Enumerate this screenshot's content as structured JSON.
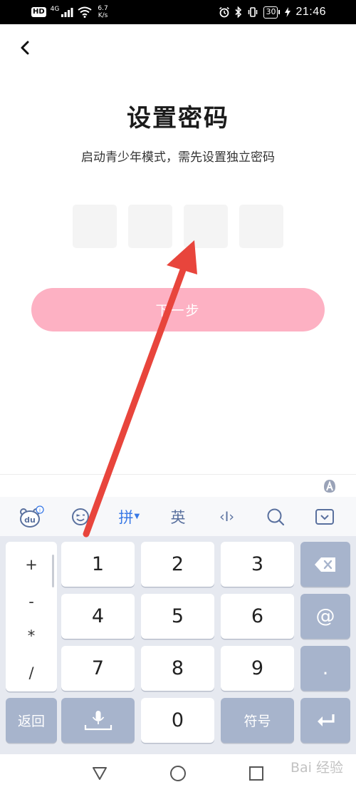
{
  "status_bar": {
    "hd": "HD",
    "network": "4G",
    "speed_value": "6.7",
    "speed_unit": "K/s",
    "battery": "30",
    "time": "21:46"
  },
  "page": {
    "title": "设置密码",
    "subtitle": "启动青少年模式，需先设置独立密码",
    "pin_length": 4,
    "next_label": "下一步",
    "accent_color": "#fdb1c3"
  },
  "keyboard": {
    "toolbar": {
      "pinyin_label": "拼",
      "english_label": "英",
      "cursor_label": "‹I›"
    },
    "symbols": [
      "+",
      "-",
      "*",
      "/"
    ],
    "digits": [
      "1",
      "2",
      "3",
      "4",
      "5",
      "6",
      "7",
      "8",
      "9",
      "0"
    ],
    "at_label": "@",
    "dot_label": ".",
    "back_label": "返回",
    "symbol_label": "符号"
  },
  "watermark": "Bai 经验"
}
